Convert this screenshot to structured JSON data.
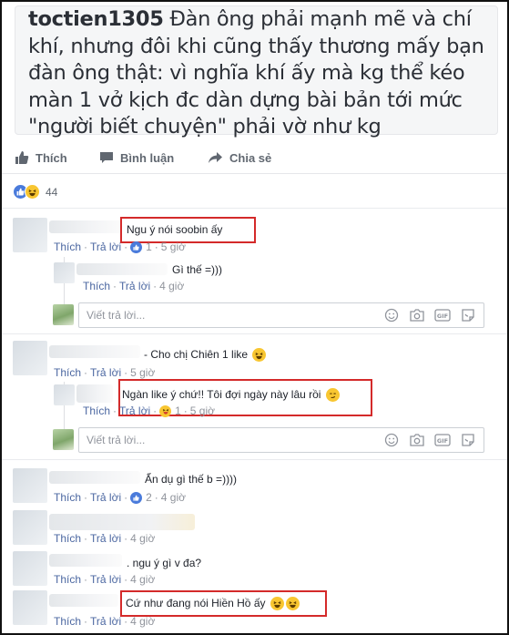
{
  "post": {
    "author": "toctien1305",
    "text": "Đàn ông phải mạnh mẽ và chí khí, nhưng đôi khi cũng thấy thương mấy bạn đàn ông thật: vì nghĩa khí ấy mà kg thể kéo màn 1 vở kịch đc dàn dựng bài bản tới mức \"người biết chuyện\" phải vờ như kg"
  },
  "actions": {
    "like": "Thích",
    "comment": "Bình luận",
    "share": "Chia sẻ"
  },
  "reactions": {
    "count": "44",
    "icons": [
      "like-icon",
      "haha-icon"
    ]
  },
  "labels": {
    "like": "Thích",
    "reply": "Trả lời",
    "dot": "·"
  },
  "reply_placeholder": "Viết trả lời...",
  "reply_icons": [
    "emoji-icon",
    "camera-icon",
    "gif-icon",
    "sticker-icon"
  ],
  "comments": [
    {
      "text": "Ngu ý nói soobin ấy",
      "reaction_count": "1",
      "time": "5 giờ",
      "highlighted": true
    },
    {
      "text": "Gì thế =)))",
      "time": "4 giờ",
      "reply": true
    },
    {
      "text": "- Cho chị Chiên 1 like",
      "emoji": "😂",
      "time": "5 giờ"
    },
    {
      "text": "Ngàn like ý chứ!! Tôi đợi ngày này lâu rồi",
      "emoji": "😏",
      "reaction_count": "1",
      "time": "5 giờ",
      "reply": true,
      "highlighted": true
    },
    {
      "text": "Ẩn dụ gì thế b =))))",
      "reaction_count": "2",
      "time": "4 giờ"
    },
    {
      "text": "",
      "time": "4 giờ"
    },
    {
      "text": ". ngu ý gì v đa?",
      "time": "4 giờ"
    },
    {
      "text": "Cứ như đang nói Hiền Hồ ấy",
      "emoji": "😂😂",
      "time": "4 giờ",
      "highlighted": true
    }
  ],
  "colors": {
    "link": "#4b67a1",
    "highlight": "#d42a2a",
    "like_blue": "#4a7bdb",
    "haha_yellow": "#f8c631"
  }
}
